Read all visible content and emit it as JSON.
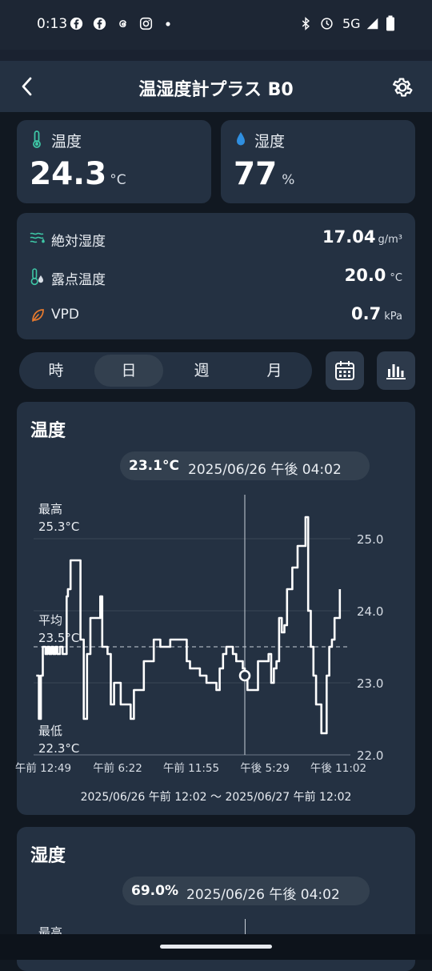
{
  "status_bar": {
    "time": "0:13",
    "network": "5G",
    "icons": [
      "facebook-icon",
      "facebook-icon",
      "threads-icon",
      "instagram-icon",
      "dot-icon",
      "bluetooth-icon",
      "alarm-icon",
      "signal-icon",
      "battery-icon"
    ]
  },
  "header": {
    "title": "温湿度計プラス B0",
    "back_icon": "chevron-left-icon",
    "settings_icon": "gear-icon"
  },
  "temperature_card": {
    "label": "温度",
    "value": "24.3",
    "unit": "°C",
    "icon": "thermometer-icon"
  },
  "humidity_card": {
    "label": "湿度",
    "value": "77",
    "unit": "%",
    "icon": "water-drop-icon"
  },
  "metrics": [
    {
      "label": "絶対湿度",
      "value": "17.04",
      "unit": "g/m³",
      "icon": "absolute-humidity-icon"
    },
    {
      "label": "露点温度",
      "value": "20.0",
      "unit": "°C",
      "icon": "dew-point-icon"
    },
    {
      "label": "VPD",
      "value": "0.7",
      "unit": "kPa",
      "icon": "leaf-icon"
    }
  ],
  "range_tabs": {
    "items": [
      "時",
      "日",
      "週",
      "月"
    ],
    "selected": "日"
  },
  "toolbar": {
    "calendar_icon": "calendar-icon",
    "chart_icon": "bar-chart-icon"
  },
  "temperature_chart": {
    "title": "温度",
    "cursor_value": "23.1°C",
    "cursor_date": "2025/06/26 午後 04:02",
    "max_label": "最高",
    "max_value": "25.3°C",
    "avg_label": "平均",
    "avg_value": "23.5°C",
    "min_label": "最低",
    "min_value": "22.3°C",
    "range_text": "2025/06/26 午前 12:02 〜 2025/06/27 午前 12:02"
  },
  "humidity_chart": {
    "title": "湿度",
    "cursor_value": "69.0%",
    "cursor_date": "2025/06/26 午後 04:02",
    "max_label": "最高"
  },
  "chart_data": {
    "type": "line",
    "title": "温度",
    "x_ticks": [
      "午前 12:49",
      "午前 6:22",
      "午前 11:55",
      "午後 5:29",
      "午後 11:02"
    ],
    "y_ticks": [
      "25.0",
      "24.0",
      "23.0",
      "22.0"
    ],
    "ylim": [
      22.0,
      25.5
    ],
    "xlim": [
      0,
      24
    ],
    "average": 23.5,
    "cursor_x": 16.0,
    "cursor_y": 23.1,
    "series": [
      {
        "x": [
          0.2,
          0.4,
          0.55,
          0.7,
          0.9,
          1.05,
          1.2,
          1.35,
          1.5,
          1.65,
          1.8,
          2.0,
          2.2,
          2.4,
          2.5,
          2.6,
          2.8,
          3.05,
          3.3,
          3.55,
          3.8,
          4.05,
          4.3,
          4.55,
          4.8,
          5.05,
          5.2,
          5.35,
          5.6,
          5.85,
          6.1,
          6.35,
          6.6,
          6.85,
          7.1,
          7.35,
          7.6,
          7.85,
          8.1,
          8.35,
          8.6,
          8.85,
          9.1,
          9.35,
          9.6,
          9.85,
          10.1,
          10.35,
          10.6,
          10.85,
          11.1,
          11.35,
          11.6,
          11.85,
          12.1,
          12.35,
          12.6,
          12.85,
          13.1,
          13.35,
          13.6,
          13.85,
          14.1,
          14.35,
          14.6,
          14.85,
          15.1,
          15.35,
          15.6,
          15.85,
          16.0,
          16.2,
          16.4,
          16.6,
          16.8,
          17.0,
          17.2,
          17.4,
          17.6,
          17.8,
          18.0,
          18.2,
          18.4,
          18.6,
          18.8,
          19.0,
          19.2,
          19.4,
          19.6,
          19.8,
          20.0,
          20.2,
          20.4,
          20.6,
          20.8,
          21.0,
          21.2,
          21.4,
          21.6,
          21.8,
          22.0,
          22.2,
          22.4,
          22.6,
          22.8,
          23.0,
          23.2
        ],
        "y": [
          23.1,
          22.5,
          23.1,
          23.5,
          23.4,
          23.5,
          23.4,
          23.5,
          23.4,
          23.5,
          23.4,
          23.5,
          23.4,
          23.4,
          24.2,
          24.3,
          24.7,
          24.7,
          24.7,
          23.6,
          22.5,
          23.4,
          23.9,
          23.9,
          23.9,
          24.2,
          23.5,
          23.5,
          23.4,
          22.7,
          23.0,
          23.0,
          22.7,
          22.7,
          22.7,
          22.5,
          22.9,
          22.9,
          22.9,
          23.3,
          23.3,
          23.3,
          23.6,
          23.6,
          23.5,
          23.5,
          23.5,
          23.6,
          23.6,
          23.6,
          23.6,
          23.6,
          23.3,
          23.2,
          23.2,
          23.2,
          23.1,
          23.1,
          23.0,
          23.0,
          23.0,
          22.9,
          23.2,
          23.4,
          23.5,
          23.5,
          23.4,
          23.3,
          23.3,
          23.2,
          23.1,
          22.9,
          22.9,
          22.9,
          22.9,
          23.3,
          23.3,
          23.3,
          23.3,
          23.4,
          23.0,
          23.2,
          23.3,
          23.9,
          23.7,
          23.8,
          24.3,
          24.3,
          24.6,
          24.6,
          24.9,
          24.9,
          24.9,
          25.3,
          24.0,
          23.5,
          23.1,
          22.7,
          22.7,
          22.3,
          22.3,
          23.1,
          23.5,
          23.6,
          23.9,
          23.9,
          24.3
        ]
      }
    ],
    "grid": true,
    "legend": "none"
  }
}
